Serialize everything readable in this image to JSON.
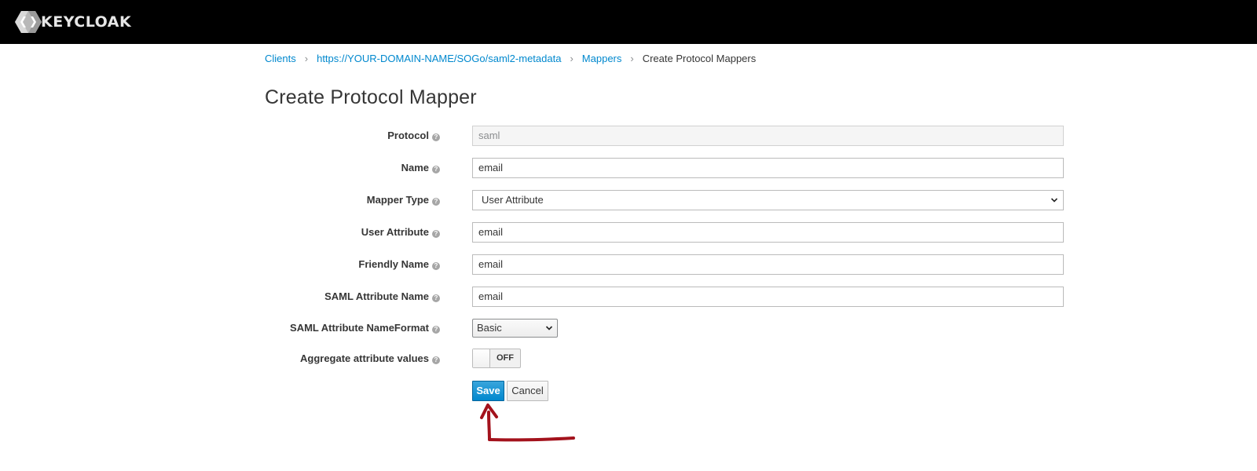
{
  "header": {
    "logo_text": "KEYCLOAK",
    "background": "#000000"
  },
  "breadcrumb": {
    "items": [
      {
        "label": "Clients"
      },
      {
        "label": "https://YOUR-DOMAIN-NAME/SOGo/saml2-metadata"
      },
      {
        "label": "Mappers"
      }
    ],
    "current": "Create Protocol Mappers",
    "separator": "›",
    "link_color": "#0088ce"
  },
  "page": {
    "title": "Create Protocol Mapper"
  },
  "form": {
    "help_glyph": "?",
    "protocol": {
      "label": "Protocol",
      "value": "saml"
    },
    "name": {
      "label": "Name",
      "value": "email"
    },
    "mapper_type": {
      "label": "Mapper Type",
      "value": "User Attribute"
    },
    "user_attribute": {
      "label": "User Attribute",
      "value": "email"
    },
    "friendly_name": {
      "label": "Friendly Name",
      "value": "email"
    },
    "saml_attribute_name": {
      "label": "SAML Attribute Name",
      "value": "email"
    },
    "saml_attribute_nameformat": {
      "label": "SAML Attribute NameFormat",
      "value": "Basic"
    },
    "aggregate_attribute_values": {
      "label": "Aggregate attribute values",
      "state": "OFF"
    }
  },
  "actions": {
    "save_label": "Save",
    "cancel_label": "Cancel",
    "primary_color": "#0088ce"
  },
  "annotation": {
    "icon": "red-arrow-icon",
    "color": "#a3121c"
  }
}
